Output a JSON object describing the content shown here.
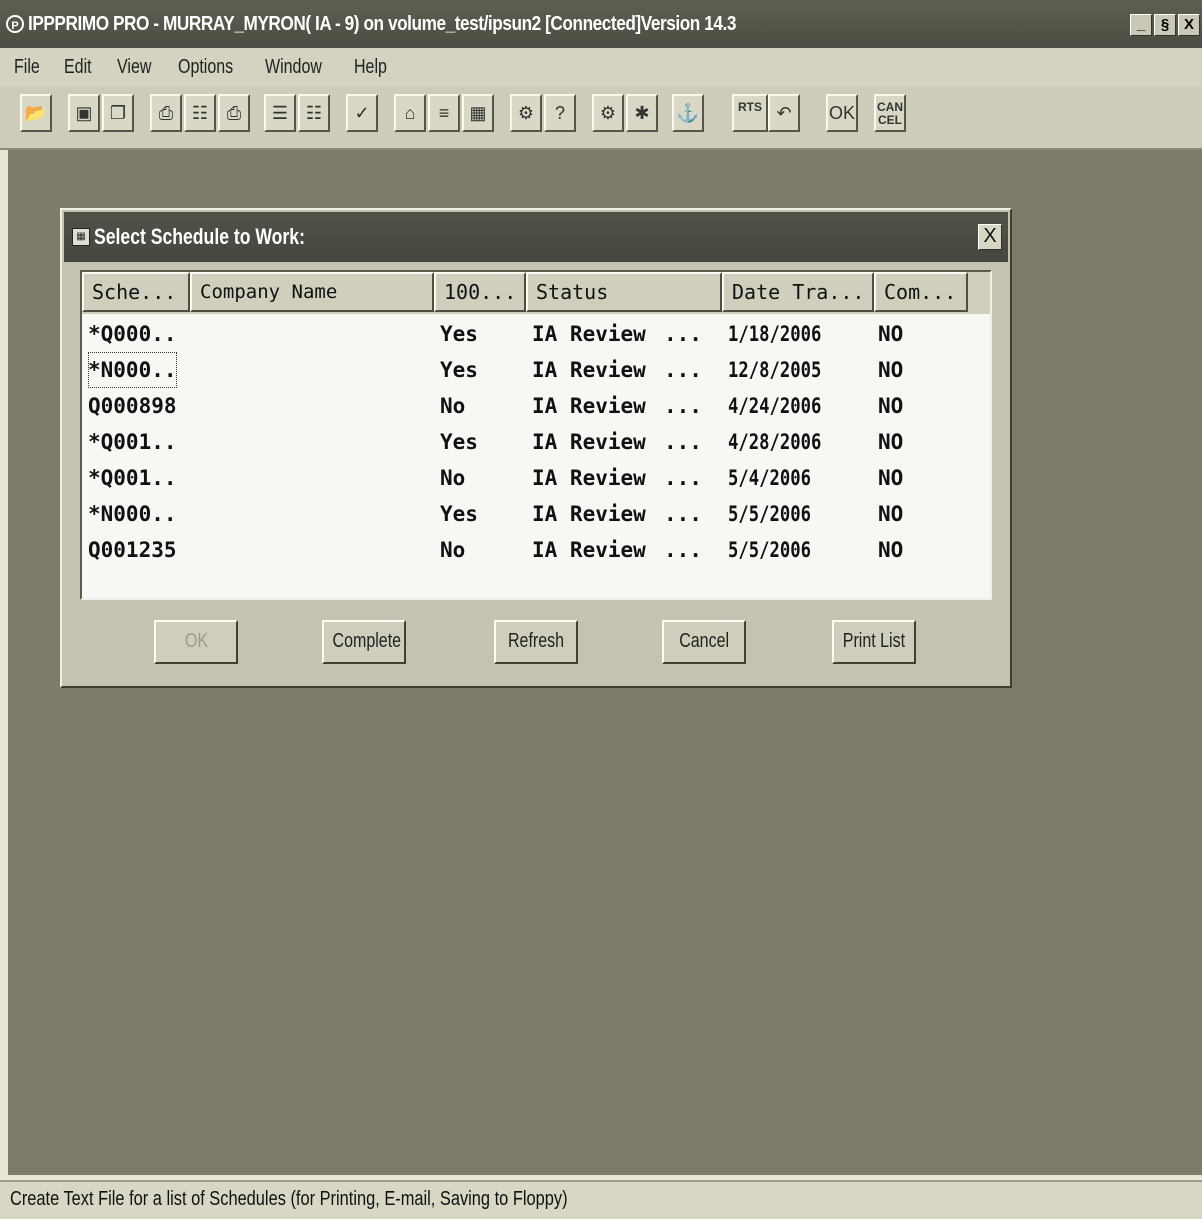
{
  "window": {
    "title": "IPPPRIMO PRO - MURRAY_MYRON( IA - 9) on volume_test/ipsun2 [Connected]Version 14.3",
    "title_icon": "P",
    "minimize": "_",
    "maximize": "§",
    "close": "X"
  },
  "menu": [
    "File",
    "Edit",
    "View",
    "Options",
    "Window",
    "Help"
  ],
  "toolbar": {
    "rts_label": "RTS",
    "ok_label": "OK",
    "cancel_label_1": "CAN",
    "cancel_label_2": "CEL",
    "icons": [
      "open-icon",
      "save-icon",
      "copy-icon",
      "print-icon",
      "print-preview-icon",
      "print-setup-icon",
      "form-icon",
      "form2-icon",
      "check-icon",
      "home-icon",
      "list-icon",
      "calendar-icon",
      "settings-icon",
      "help-icon",
      "group-icon",
      "gear-icon",
      "trash-icon",
      "rts-icon",
      "undo-icon"
    ]
  },
  "dialog": {
    "title": "Select Schedule to Work:",
    "close": "X",
    "columns": [
      "Sche...",
      "Company Name",
      "100...",
      "Status",
      "Date Tra...",
      "Com..."
    ],
    "rows": [
      {
        "schedule": "*Q000..",
        "company": "",
        "pct": "Yes",
        "status": "IA Review",
        "dots": "...",
        "date": "1/18/2006",
        "com": "NO"
      },
      {
        "schedule": "*N000..",
        "company": "",
        "pct": "Yes",
        "status": "IA Review",
        "dots": "...",
        "date": "12/8/2005",
        "com": "NO"
      },
      {
        "schedule": "Q000898",
        "company": "",
        "pct": "No",
        "status": "IA Review",
        "dots": "...",
        "date": "4/24/2006",
        "com": "NO"
      },
      {
        "schedule": "*Q001..",
        "company": "",
        "pct": "Yes",
        "status": "IA Review",
        "dots": "...",
        "date": "4/28/2006",
        "com": "NO"
      },
      {
        "schedule": "*Q001..",
        "company": "",
        "pct": "No",
        "status": "IA Review",
        "dots": "...",
        "date": "5/4/2006",
        "com": "NO"
      },
      {
        "schedule": "*N000..",
        "company": "",
        "pct": "Yes",
        "status": "IA Review",
        "dots": "...",
        "date": "5/5/2006",
        "com": "NO"
      },
      {
        "schedule": "Q001235",
        "company": "",
        "pct": "No",
        "status": "IA Review",
        "dots": "...",
        "date": "5/5/2006",
        "com": "NO"
      }
    ],
    "buttons": {
      "ok": "OK",
      "complete": "Complete",
      "refresh": "Refresh",
      "cancel": "Cancel",
      "print_list": "Print List"
    }
  },
  "status_bar": {
    "text": "Create Text File for a list of Schedules (for Printing, E-mail, Saving to Floppy)"
  }
}
